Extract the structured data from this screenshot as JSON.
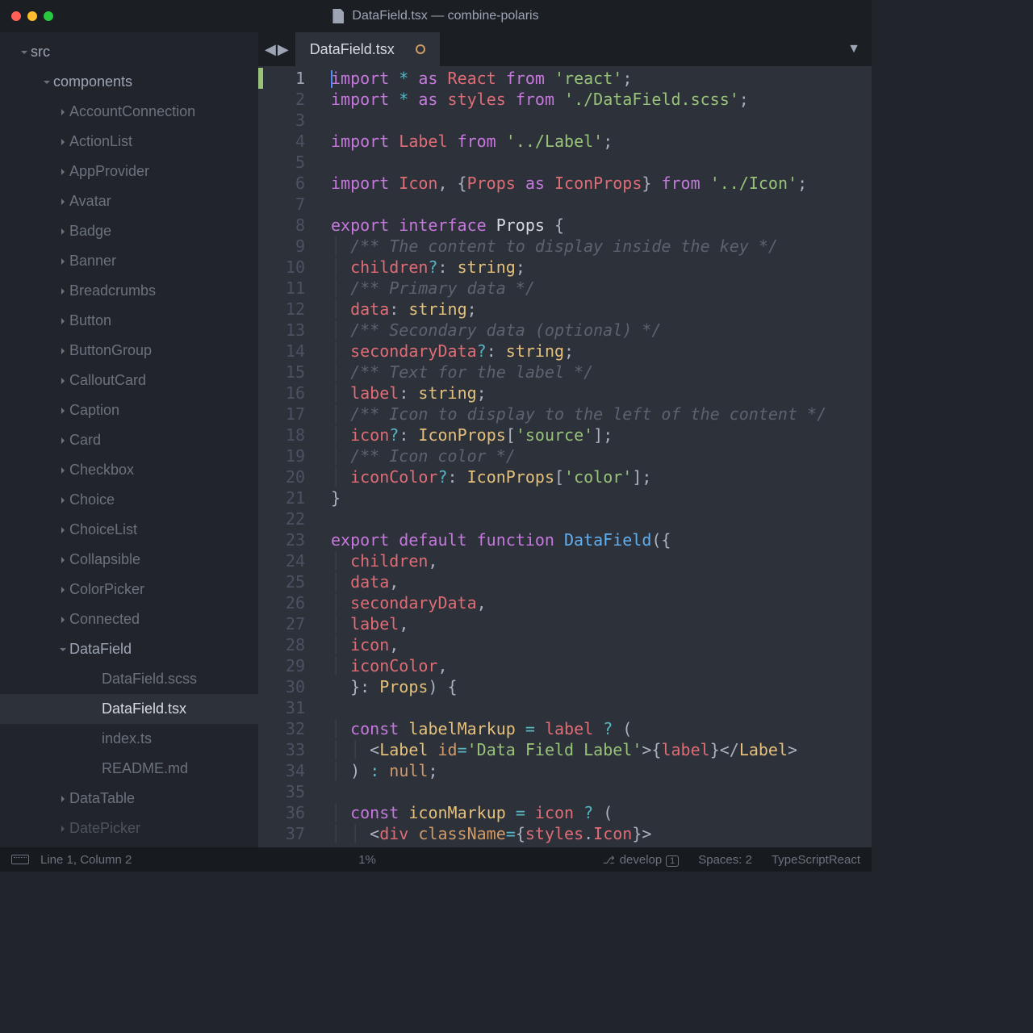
{
  "title": "DataField.tsx — combine-polaris",
  "sidebar": {
    "root": "src",
    "folder": "components",
    "items": [
      "AccountConnection",
      "ActionList",
      "AppProvider",
      "Avatar",
      "Badge",
      "Banner",
      "Breadcrumbs",
      "Button",
      "ButtonGroup",
      "CalloutCard",
      "Caption",
      "Card",
      "Checkbox",
      "Choice",
      "ChoiceList",
      "Collapsible",
      "ColorPicker",
      "Connected"
    ],
    "open_folder": "DataField",
    "files": [
      "DataField.scss",
      "DataField.tsx",
      "index.ts",
      "README.md"
    ],
    "after": [
      "DataTable",
      "DatePicker"
    ],
    "active": "DataField.tsx"
  },
  "tab": {
    "name": "DataField.tsx"
  },
  "status": {
    "position": "Line 1, Column 2",
    "percent": "1%",
    "branch": "develop",
    "branch_badge": "1",
    "spaces": "Spaces: 2",
    "lang": "TypeScriptReact"
  },
  "code_lines": 37,
  "code": [
    [
      [
        "cursor",
        ""
      ],
      [
        "kw",
        "import"
      ],
      [
        "pl",
        " "
      ],
      [
        "op",
        "*"
      ],
      [
        "pl",
        " "
      ],
      [
        "kw",
        "as"
      ],
      [
        "pl",
        " "
      ],
      [
        "var",
        "React"
      ],
      [
        "pl",
        " "
      ],
      [
        "kw",
        "from"
      ],
      [
        "pl",
        " "
      ],
      [
        "str",
        "'react'"
      ],
      [
        "pl",
        ";"
      ]
    ],
    [
      [
        "kw",
        "import"
      ],
      [
        "pl",
        " "
      ],
      [
        "op",
        "*"
      ],
      [
        "pl",
        " "
      ],
      [
        "kw",
        "as"
      ],
      [
        "pl",
        " "
      ],
      [
        "var",
        "styles"
      ],
      [
        "pl",
        " "
      ],
      [
        "kw",
        "from"
      ],
      [
        "pl",
        " "
      ],
      [
        "str",
        "'./DataField.scss'"
      ],
      [
        "pl",
        ";"
      ]
    ],
    [],
    [
      [
        "kw",
        "import"
      ],
      [
        "pl",
        " "
      ],
      [
        "var",
        "Label"
      ],
      [
        "pl",
        " "
      ],
      [
        "kw",
        "from"
      ],
      [
        "pl",
        " "
      ],
      [
        "str",
        "'../Label'"
      ],
      [
        "pl",
        ";"
      ]
    ],
    [],
    [
      [
        "kw",
        "import"
      ],
      [
        "pl",
        " "
      ],
      [
        "var",
        "Icon"
      ],
      [
        "pl",
        ", {"
      ],
      [
        "var",
        "Props"
      ],
      [
        "pl",
        " "
      ],
      [
        "kw",
        "as"
      ],
      [
        "pl",
        " "
      ],
      [
        "var",
        "IconProps"
      ],
      [
        "pl",
        "} "
      ],
      [
        "kw",
        "from"
      ],
      [
        "pl",
        " "
      ],
      [
        "str",
        "'../Icon'"
      ],
      [
        "pl",
        ";"
      ]
    ],
    [],
    [
      [
        "kw",
        "export"
      ],
      [
        "pl",
        " "
      ],
      [
        "kw",
        "interface"
      ],
      [
        "pl",
        " "
      ],
      [
        "white",
        "Props"
      ],
      [
        "pl",
        " {"
      ]
    ],
    [
      [
        "indent",
        "  "
      ],
      [
        "cm",
        "/** The content to display inside the key */"
      ]
    ],
    [
      [
        "indent",
        "  "
      ],
      [
        "var",
        "children"
      ],
      [
        "op",
        "?"
      ],
      [
        "pl",
        ": "
      ],
      [
        "type",
        "string"
      ],
      [
        "pl",
        ";"
      ]
    ],
    [
      [
        "indent",
        "  "
      ],
      [
        "cm",
        "/** Primary data */"
      ]
    ],
    [
      [
        "indent",
        "  "
      ],
      [
        "var",
        "data"
      ],
      [
        "pl",
        ": "
      ],
      [
        "type",
        "string"
      ],
      [
        "pl",
        ";"
      ]
    ],
    [
      [
        "indent",
        "  "
      ],
      [
        "cm",
        "/** Secondary data (optional) */"
      ]
    ],
    [
      [
        "indent",
        "  "
      ],
      [
        "var",
        "secondaryData"
      ],
      [
        "op",
        "?"
      ],
      [
        "pl",
        ": "
      ],
      [
        "type",
        "string"
      ],
      [
        "pl",
        ";"
      ]
    ],
    [
      [
        "indent",
        "  "
      ],
      [
        "cm",
        "/** Text for the label */"
      ]
    ],
    [
      [
        "indent",
        "  "
      ],
      [
        "var",
        "label"
      ],
      [
        "pl",
        ": "
      ],
      [
        "type",
        "string"
      ],
      [
        "pl",
        ";"
      ]
    ],
    [
      [
        "indent",
        "  "
      ],
      [
        "cm",
        "/** Icon to display to the left of the content */"
      ]
    ],
    [
      [
        "indent",
        "  "
      ],
      [
        "var",
        "icon"
      ],
      [
        "op",
        "?"
      ],
      [
        "pl",
        ": "
      ],
      [
        "type",
        "IconProps"
      ],
      [
        "pl",
        "["
      ],
      [
        "str",
        "'source'"
      ],
      [
        "pl",
        "];"
      ]
    ],
    [
      [
        "indent",
        "  "
      ],
      [
        "cm",
        "/** Icon color */"
      ]
    ],
    [
      [
        "indent",
        "  "
      ],
      [
        "var",
        "iconColor"
      ],
      [
        "op",
        "?"
      ],
      [
        "pl",
        ": "
      ],
      [
        "type",
        "IconProps"
      ],
      [
        "pl",
        "["
      ],
      [
        "str",
        "'color'"
      ],
      [
        "pl",
        "];"
      ]
    ],
    [
      [
        "pl",
        "}"
      ]
    ],
    [],
    [
      [
        "kw",
        "export"
      ],
      [
        "pl",
        " "
      ],
      [
        "kw",
        "default"
      ],
      [
        "pl",
        " "
      ],
      [
        "kw",
        "function"
      ],
      [
        "pl",
        " "
      ],
      [
        "fn",
        "DataField"
      ],
      [
        "pl",
        "({"
      ]
    ],
    [
      [
        "indent",
        "  "
      ],
      [
        "var",
        "children"
      ],
      [
        "pl",
        ","
      ]
    ],
    [
      [
        "indent",
        "  "
      ],
      [
        "var",
        "data"
      ],
      [
        "pl",
        ","
      ]
    ],
    [
      [
        "indent",
        "  "
      ],
      [
        "var",
        "secondaryData"
      ],
      [
        "pl",
        ","
      ]
    ],
    [
      [
        "indent",
        "  "
      ],
      [
        "var",
        "label"
      ],
      [
        "pl",
        ","
      ]
    ],
    [
      [
        "indent",
        "  "
      ],
      [
        "var",
        "icon"
      ],
      [
        "pl",
        ","
      ]
    ],
    [
      [
        "indent",
        "  "
      ],
      [
        "var",
        "iconColor"
      ],
      [
        "pl",
        ","
      ]
    ],
    [
      [
        "pl",
        "  }: "
      ],
      [
        "type",
        "Props"
      ],
      [
        "pl",
        ") {"
      ]
    ],
    [],
    [
      [
        "indent",
        "  "
      ],
      [
        "kw",
        "const"
      ],
      [
        "pl",
        " "
      ],
      [
        "type",
        "labelMarkup"
      ],
      [
        "pl",
        " "
      ],
      [
        "op",
        "="
      ],
      [
        "pl",
        " "
      ],
      [
        "var",
        "label"
      ],
      [
        "pl",
        " "
      ],
      [
        "op",
        "?"
      ],
      [
        "pl",
        " ("
      ]
    ],
    [
      [
        "indent",
        "    "
      ],
      [
        "pl",
        "<"
      ],
      [
        "type",
        "Label"
      ],
      [
        "pl",
        " "
      ],
      [
        "num",
        "id"
      ],
      [
        "op",
        "="
      ],
      [
        "str",
        "'Data Field Label'"
      ],
      [
        "pl",
        ">{"
      ],
      [
        "var",
        "label"
      ],
      [
        "pl",
        "}</"
      ],
      [
        "type",
        "Label"
      ],
      [
        "pl",
        ">"
      ]
    ],
    [
      [
        "indent",
        "  "
      ],
      [
        "pl",
        ") "
      ],
      [
        "op",
        ":"
      ],
      [
        "pl",
        " "
      ],
      [
        "num",
        "null"
      ],
      [
        "pl",
        ";"
      ]
    ],
    [],
    [
      [
        "indent",
        "  "
      ],
      [
        "kw",
        "const"
      ],
      [
        "pl",
        " "
      ],
      [
        "type",
        "iconMarkup"
      ],
      [
        "pl",
        " "
      ],
      [
        "op",
        "="
      ],
      [
        "pl",
        " "
      ],
      [
        "var",
        "icon"
      ],
      [
        "pl",
        " "
      ],
      [
        "op",
        "?"
      ],
      [
        "pl",
        " ("
      ]
    ],
    [
      [
        "indent",
        "    "
      ],
      [
        "pl",
        "<"
      ],
      [
        "var",
        "div"
      ],
      [
        "pl",
        " "
      ],
      [
        "num",
        "className"
      ],
      [
        "op",
        "="
      ],
      [
        "pl",
        "{"
      ],
      [
        "var",
        "styles"
      ],
      [
        "pl",
        "."
      ],
      [
        "var",
        "Icon"
      ],
      [
        "pl",
        "}>"
      ]
    ]
  ]
}
